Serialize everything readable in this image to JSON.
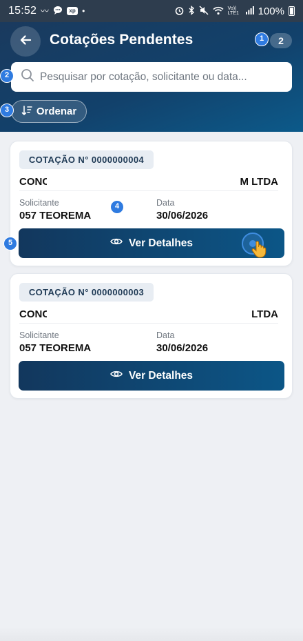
{
  "status_bar": {
    "time": "15:52",
    "xp_label": "xp",
    "lte_label": "Vo)) LTE1",
    "battery": "100%"
  },
  "header": {
    "title": "Cotações Pendentes",
    "count": "2",
    "search_placeholder": "Pesquisar por cotação, solicitante ou data...",
    "sort_label": "Ordenar"
  },
  "markers": [
    "1",
    "2",
    "3",
    "4",
    "5"
  ],
  "quotes": [
    {
      "number": "COTAÇÃO N° 0000000004",
      "company_left": "CONC",
      "company_right": "M LTDA",
      "requester_label": "Solicitante",
      "requester": "057 TEOREMA",
      "date_label": "Data",
      "date": "30/06/2026",
      "button_label": "Ver Detalhes"
    },
    {
      "number": "COTAÇÃO N° 0000000003",
      "company_left": "CONC",
      "company_right": "LTDA",
      "requester_label": "Solicitante",
      "requester": "057 TEOREMA",
      "date_label": "Data",
      "date": "30/06/2026",
      "button_label": "Ver Detalhes"
    }
  ],
  "colors": {
    "header_gradient_start": "#1a3a5e",
    "header_gradient_end": "#0c5a8a",
    "button_gradient_start": "#12375d",
    "button_gradient_end": "#0c5687",
    "marker": "#2f7be0",
    "background": "#eef0f4"
  }
}
